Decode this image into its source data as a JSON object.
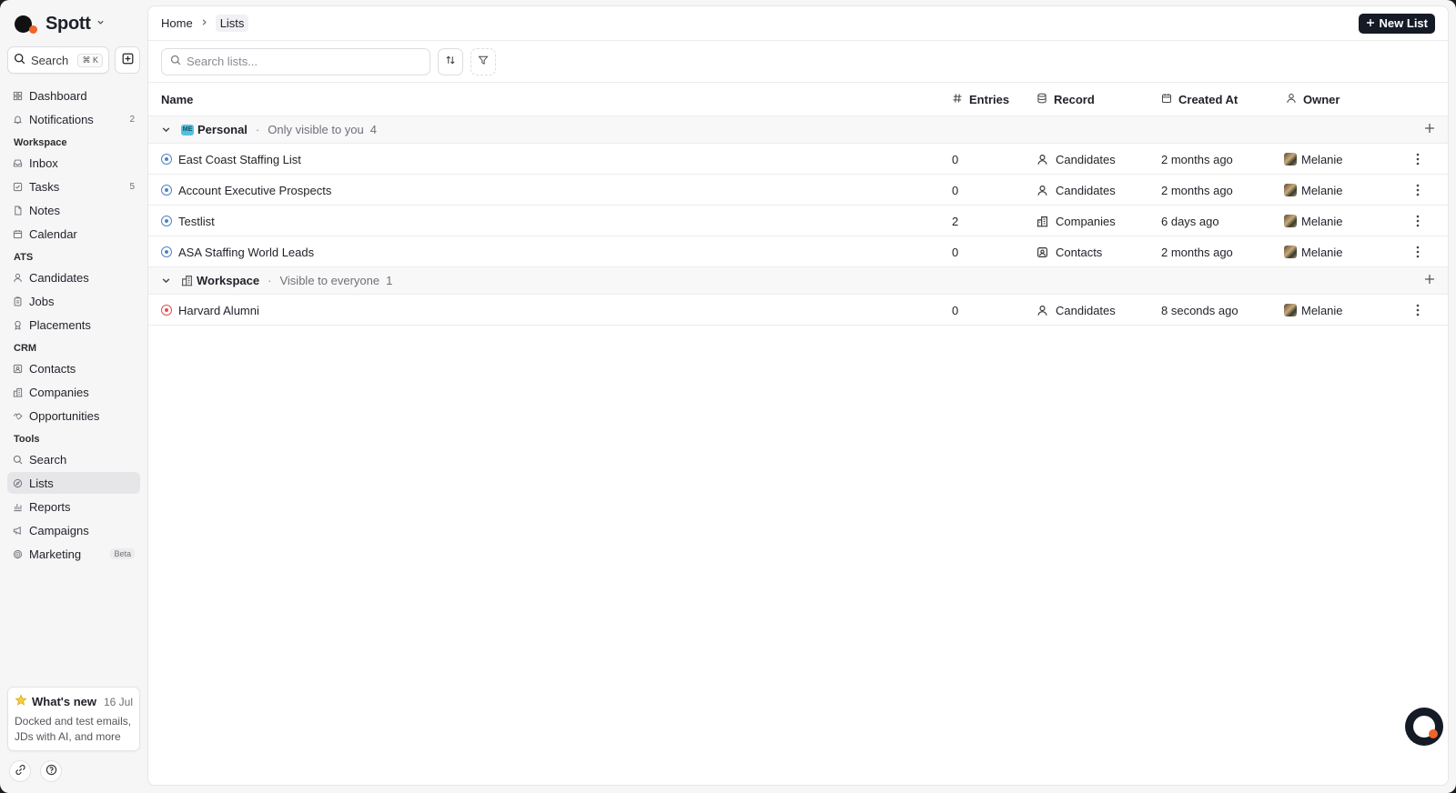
{
  "app": {
    "name": "Spott"
  },
  "sidebar": {
    "search_label": "Search",
    "search_shortcut": "⌘ K",
    "items_top": [
      {
        "label": "Dashboard",
        "icon": "grid-icon"
      },
      {
        "label": "Notifications",
        "icon": "bell-icon",
        "count": "2"
      }
    ],
    "sections": [
      {
        "title": "Workspace",
        "items": [
          {
            "label": "Inbox",
            "icon": "inbox-icon"
          },
          {
            "label": "Tasks",
            "icon": "check-square-icon",
            "count": "5"
          },
          {
            "label": "Notes",
            "icon": "file-icon"
          },
          {
            "label": "Calendar",
            "icon": "calendar-icon"
          }
        ]
      },
      {
        "title": "ATS",
        "items": [
          {
            "label": "Candidates",
            "icon": "user-icon"
          },
          {
            "label": "Jobs",
            "icon": "clipboard-icon"
          },
          {
            "label": "Placements",
            "icon": "award-icon"
          }
        ]
      },
      {
        "title": "CRM",
        "items": [
          {
            "label": "Contacts",
            "icon": "contact-icon"
          },
          {
            "label": "Companies",
            "icon": "building-icon"
          },
          {
            "label": "Opportunities",
            "icon": "handshake-icon"
          }
        ]
      },
      {
        "title": "Tools",
        "items": [
          {
            "label": "Search",
            "icon": "search-icon"
          },
          {
            "label": "Lists",
            "icon": "list-icon",
            "active": true
          },
          {
            "label": "Reports",
            "icon": "bar-chart-icon"
          },
          {
            "label": "Campaigns",
            "icon": "megaphone-icon"
          },
          {
            "label": "Marketing",
            "icon": "target-icon",
            "badge": "Beta"
          }
        ]
      }
    ],
    "whats_new": {
      "title": "What's new",
      "date": "16 Jul",
      "desc": "Docked and test emails, JDs with AI, and more"
    }
  },
  "header": {
    "breadcrumb": [
      "Home",
      "Lists"
    ],
    "new_list_label": "New List"
  },
  "toolbar": {
    "search_placeholder": "Search lists..."
  },
  "table": {
    "columns": {
      "name": "Name",
      "entries": "Entries",
      "record": "Record",
      "created": "Created At",
      "owner": "Owner"
    },
    "groups": [
      {
        "badge": "ME",
        "name": "Personal",
        "desc": "Only visible to you",
        "count": "4",
        "rows": [
          {
            "name": "East Coast Staffing List",
            "entries": "0",
            "record": "Candidates",
            "record_icon": "user-icon",
            "created": "2 months ago",
            "owner": "Melanie",
            "color": "blue"
          },
          {
            "name": "Account Executive Prospects",
            "entries": "0",
            "record": "Candidates",
            "record_icon": "user-icon",
            "created": "2 months ago",
            "owner": "Melanie",
            "color": "blue"
          },
          {
            "name": "Testlist",
            "entries": "2",
            "record": "Companies",
            "record_icon": "building-icon",
            "created": "6 days ago",
            "owner": "Melanie",
            "color": "blue"
          },
          {
            "name": "ASA Staffing World Leads",
            "entries": "0",
            "record": "Contacts",
            "record_icon": "contact-icon",
            "created": "2 months ago",
            "owner": "Melanie",
            "color": "blue"
          }
        ]
      },
      {
        "badge": "",
        "name": "Workspace",
        "desc": "Visible to everyone",
        "count": "1",
        "rows": [
          {
            "name": "Harvard Alumni",
            "entries": "0",
            "record": "Candidates",
            "record_icon": "user-icon",
            "created": "8 seconds ago",
            "owner": "Melanie",
            "color": "red"
          }
        ]
      }
    ]
  },
  "colors": {
    "accent_dark": "#141a26",
    "brand_orange": "#f0642a",
    "list_blue": "#4f84c4",
    "list_red": "#e0504b"
  }
}
